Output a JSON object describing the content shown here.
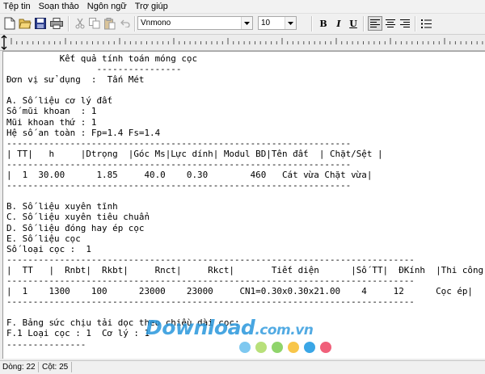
{
  "menu": [
    "Tệp tin",
    "Soạn thảo",
    "Ngôn ngữ",
    "Trợ giúp"
  ],
  "toolbar": {
    "font_name": "Vnmono",
    "font_size": "10",
    "bold_label": "B",
    "italic_label": "I",
    "underline_label": "U"
  },
  "document": {
    "lines": [
      "          Kết quả tính toán móng cọc",
      "                 ----------------",
      "Đơn vị sử dụng  :  Tấn Mét",
      "",
      "A. Số liệu cơ lý đất",
      "Số mũi khoan  : 1",
      "Mũi khoan thứ : 1",
      "Hệ số an toàn : Fp=1.4 Fs=1.4",
      "-----------------------------------------------------------------",
      "| TT|   h     |Dtrọng  |Góc Ms|Lực dính| Modul BD|Tên đất  | Chặt/Sệt |",
      "-----------------------------------------------------------------",
      "|  1  30.00      1.85     40.0    0.30        460   Cát vừa Chặt vừa|",
      "-----------------------------------------------------------------",
      "",
      "B. Số liệu xuyên tĩnh",
      "C. Số liệu xuyên tiêu chuẩn",
      "D. Số liệu đóng hay ép cọc",
      "E. Số liệu cọc",
      "Số loại cọc :  1",
      "-----------------------------------------------------------------------------",
      "|  TT   |  Rnbt|  Rkbt|     Rnct|     Rkct|       Tiết diện      |Số TT|  ĐKính  |Thi công|",
      "-----------------------------------------------------------------------------",
      "|  1    1300    100      23000    23000     CN1=0.30x0.30x21.00    4     12      Cọc ép|",
      "-----------------------------------------------------------------------------",
      "",
      "F. Bảng sức chịu tải dọc theo chiều dài cọc:",
      "F.1 Loại cọc : 1  Cơ lý : 1",
      "---------------"
    ]
  },
  "watermark": {
    "text": "Download",
    "tld": ".com.vn",
    "dot_colors": [
      "#7ec8f0",
      "#b8e07a",
      "#8fd46b",
      "#f8c64a",
      "#3aa6e6",
      "#f0607a"
    ]
  },
  "status": {
    "line_text": "Dòng: 22",
    "col_text": "Cột: 25"
  }
}
